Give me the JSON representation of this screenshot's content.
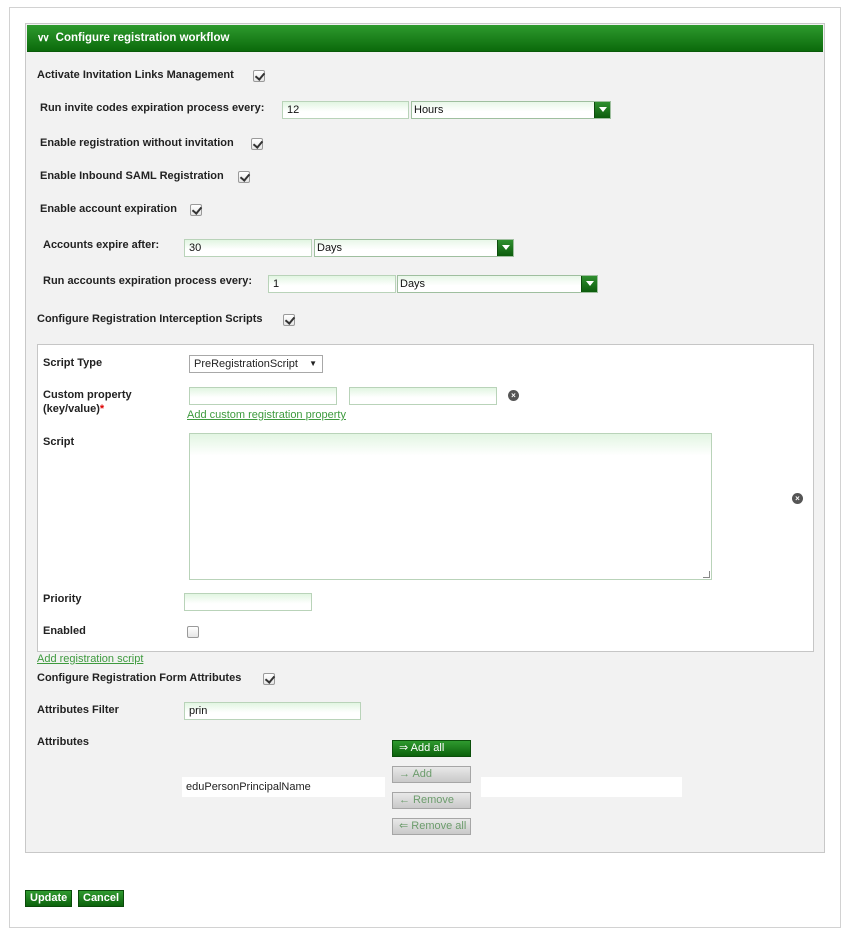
{
  "panel": {
    "title": "Configure registration workflow"
  },
  "fields": {
    "activate_invitation_label": "Activate Invitation Links Management",
    "activate_invitation_checked": true,
    "invite_expiration_label": "Run invite codes expiration process every:",
    "invite_expiration_value": "12",
    "invite_expiration_unit": "Hours",
    "reg_without_invitation_label": "Enable registration without invitation",
    "reg_without_invitation_checked": true,
    "inbound_saml_label": "Enable Inbound SAML Registration",
    "inbound_saml_checked": true,
    "account_expiration_label": "Enable account expiration",
    "account_expiration_checked": true,
    "accounts_expire_label": "Accounts expire after:",
    "accounts_expire_value": "30",
    "accounts_expire_unit": "Days",
    "accounts_process_label": "Run accounts expiration process every:",
    "accounts_process_value": "1",
    "accounts_process_unit": "Days",
    "interception_scripts_label": "Configure Registration Interception Scripts",
    "interception_scripts_checked": true
  },
  "script_box": {
    "script_type_label": "Script Type",
    "script_type_value": "PreRegistrationScript",
    "custom_property_label": "Custom property",
    "custom_property_sub": "(key/value)",
    "required_mark": "*",
    "custom_key": "",
    "custom_value": "",
    "add_property_link": "Add custom registration property",
    "script_label": "Script",
    "script_value": "",
    "priority_label": "Priority",
    "priority_value": "",
    "enabled_label": "Enabled",
    "enabled_checked": false
  },
  "add_script_link": "Add registration script",
  "form_attributes": {
    "label": "Configure Registration Form Attributes",
    "checked": true,
    "filter_label": "Attributes Filter",
    "filter_value": "prin",
    "attributes_label": "Attributes",
    "available": [
      "eduPersonPrincipalName"
    ],
    "selected": [],
    "add_all": "⇒ Add all",
    "add": "→ Add",
    "remove": "← Remove",
    "remove_all": "⇐ Remove all"
  },
  "footer": {
    "update": "Update",
    "cancel": "Cancel"
  }
}
